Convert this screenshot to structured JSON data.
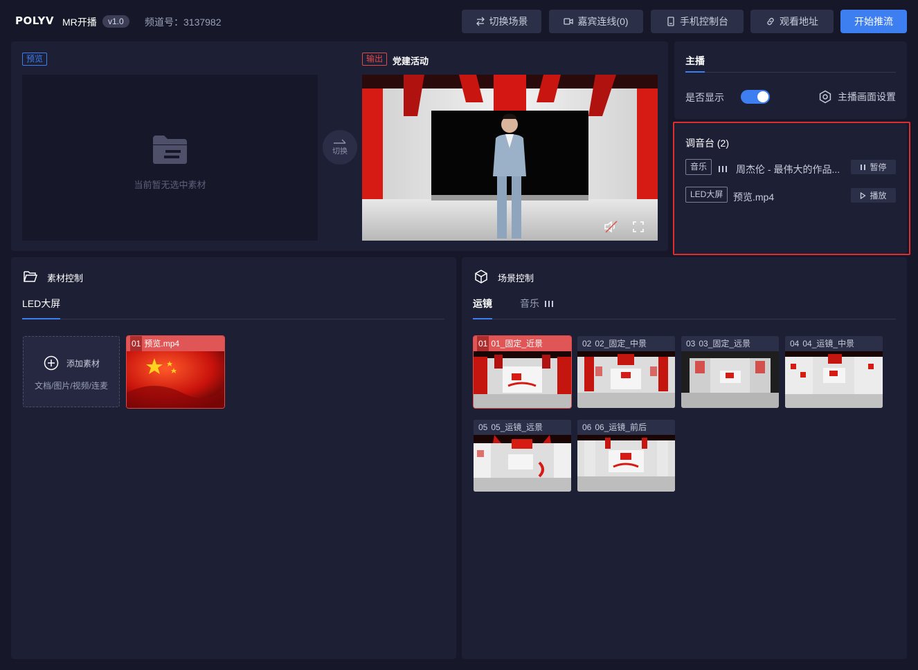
{
  "header": {
    "logo": "POLYV",
    "app_name": "MR开播",
    "version": "v1.0",
    "channel_label": "频道号：3137982",
    "buttons": {
      "switch_scene": "切换场景",
      "guest_connect": "嘉宾连线(0)",
      "mobile_console": "手机控制台",
      "watch_url": "观看地址",
      "start_push": "开始推流"
    }
  },
  "stage": {
    "preview_tag": "预览",
    "preview_empty": "当前暂无选中素材",
    "switch_label": "切换",
    "output_tag": "输出",
    "output_title": "党建活动"
  },
  "anchor": {
    "tab": "主播",
    "display_label": "是否显示",
    "display_on": true,
    "settings_label": "主播画面设置"
  },
  "mixer": {
    "title": "调音台 (2)",
    "tracks": [
      {
        "tag": "音乐",
        "name": "周杰伦 - 最伟大的作品...",
        "action": "暂停",
        "action_icon": "pause-icon"
      },
      {
        "tag": "LED大屏",
        "name": "预览.mp4",
        "action": "播放",
        "action_icon": "play-icon"
      }
    ]
  },
  "material": {
    "title": "素材控制",
    "tab": "LED大屏",
    "add_title": "添加素材",
    "add_sub": "文档/图片/视频/连麦",
    "items": [
      {
        "num": "01",
        "name": "预览.mp4",
        "selected": true
      }
    ]
  },
  "scene": {
    "title": "场景控制",
    "tabs": [
      "运镜",
      "音乐"
    ],
    "items": [
      {
        "num": "01",
        "name": "01_固定_近景",
        "selected": true
      },
      {
        "num": "02",
        "name": "02_固定_中景"
      },
      {
        "num": "03",
        "name": "03_固定_远景"
      },
      {
        "num": "04",
        "name": "04_运镜_中景"
      },
      {
        "num": "05",
        "name": "05_运镜_远景"
      },
      {
        "num": "06",
        "name": "06_运镜_前后"
      }
    ]
  },
  "colors": {
    "accent": "#3d7ef0",
    "danger": "#e24a4a",
    "panel": "#1d1f35",
    "bg": "#161829"
  }
}
